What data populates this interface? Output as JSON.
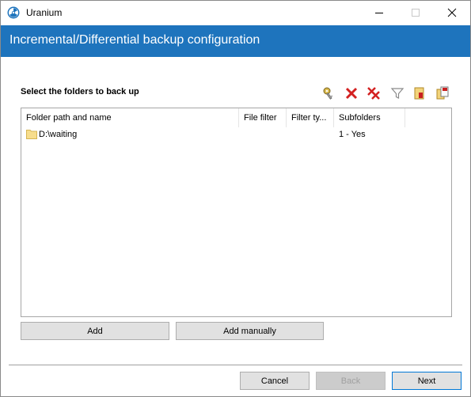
{
  "window": {
    "title": "Uranium",
    "app_icon": "radiation-icon",
    "controls": [
      "minimize-icon",
      "maximize-icon",
      "close-icon"
    ]
  },
  "header": {
    "title": "Incremental/Differential backup configuration",
    "background": "#1e74bd"
  },
  "section": {
    "label": "Select the folders to back up"
  },
  "toolbar": {
    "icons": [
      "key-icon",
      "delete-icon",
      "delete-all-icon",
      "filter-icon",
      "import-icon",
      "copy-icon"
    ]
  },
  "list": {
    "columns": [
      "Folder path and name",
      "File filter",
      "Filter ty...",
      "Subfolders"
    ],
    "rows": [
      {
        "folder": "D:\\waiting",
        "file_filter": "",
        "filter_type": "",
        "subfolders": "1 - Yes"
      }
    ]
  },
  "buttons": {
    "add": "Add",
    "add_manually": "Add manually",
    "cancel": "Cancel",
    "back": "Back",
    "next": "Next"
  },
  "colors": {
    "accent": "#1e74bd",
    "default_button_border": "#0078d7",
    "delete_red": "#d32020"
  }
}
